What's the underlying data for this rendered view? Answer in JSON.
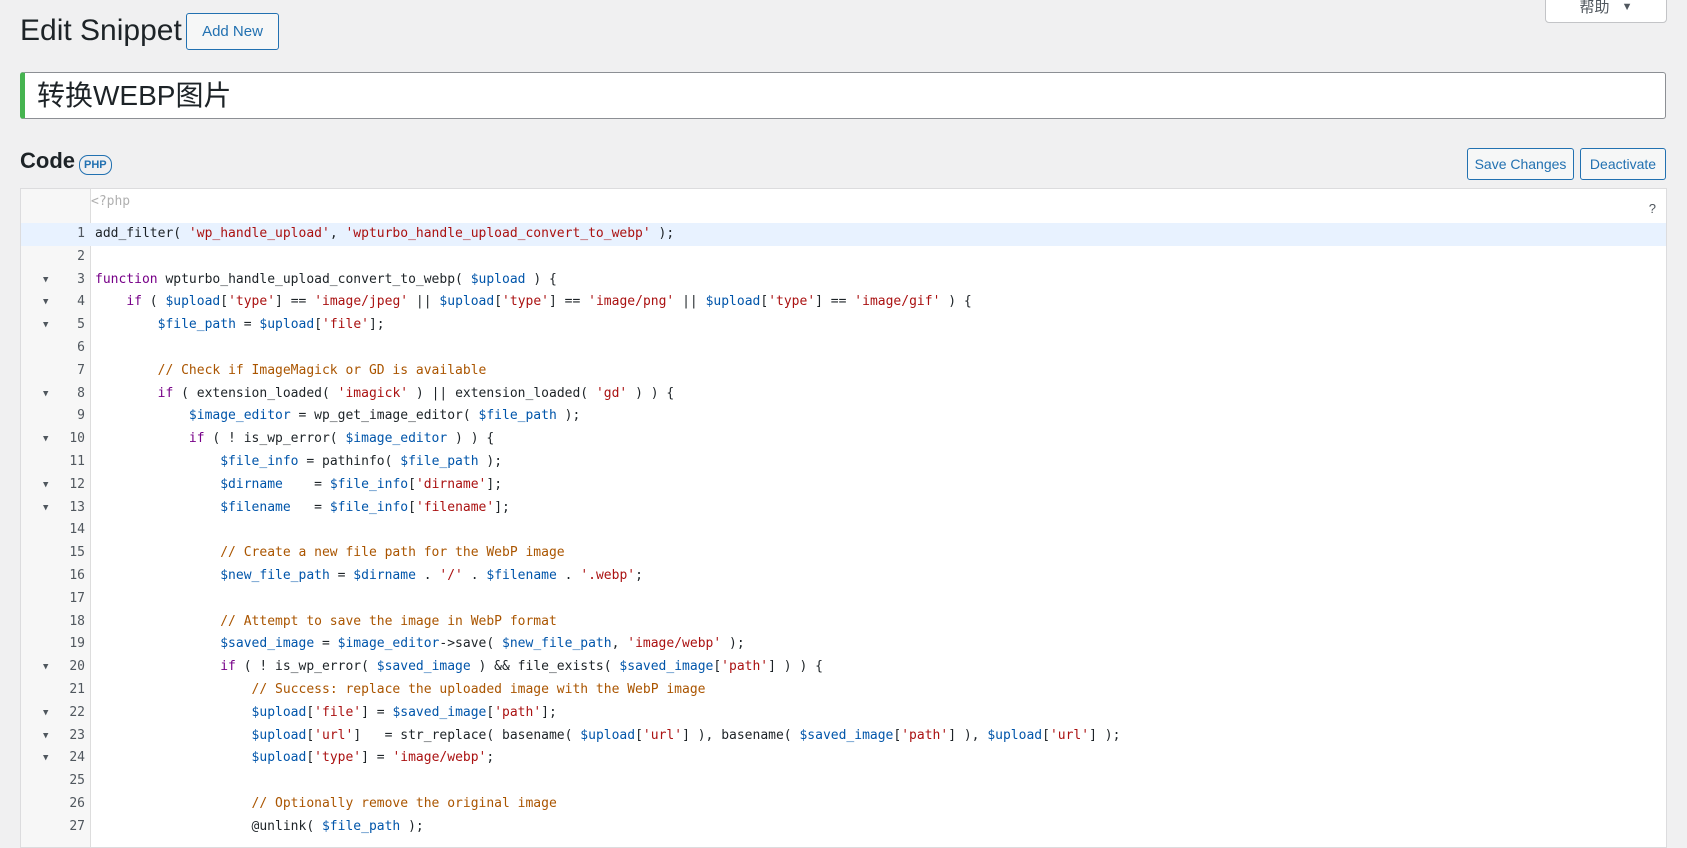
{
  "help_tab": {
    "label": "帮助"
  },
  "header": {
    "title": "Edit Snippet",
    "add_new_label": "Add New"
  },
  "snippet": {
    "title_value": "转换WEBP图片"
  },
  "code_section": {
    "heading": "Code",
    "language_badge": "PHP",
    "save_label": "Save Changes",
    "deactivate_label": "Deactivate"
  },
  "editor": {
    "php_open_tag": "<?php",
    "help_mark": "?",
    "lines": [
      {
        "n": "1",
        "fold": false,
        "code": "add_filter( 'wp_handle_upload', 'wpturbo_handle_upload_convert_to_webp' );"
      },
      {
        "n": "2",
        "fold": false,
        "code": ""
      },
      {
        "n": "3",
        "fold": true,
        "code": "function wpturbo_handle_upload_convert_to_webp( $upload ) {"
      },
      {
        "n": "4",
        "fold": true,
        "code": "    if ( $upload['type'] == 'image/jpeg' || $upload['type'] == 'image/png' || $upload['type'] == 'image/gif' ) {"
      },
      {
        "n": "5",
        "fold": true,
        "code": "        $file_path = $upload['file'];"
      },
      {
        "n": "6",
        "fold": false,
        "code": ""
      },
      {
        "n": "7",
        "fold": false,
        "code": "        // Check if ImageMagick or GD is available"
      },
      {
        "n": "8",
        "fold": true,
        "code": "        if ( extension_loaded( 'imagick' ) || extension_loaded( 'gd' ) ) {"
      },
      {
        "n": "9",
        "fold": false,
        "code": "            $image_editor = wp_get_image_editor( $file_path );"
      },
      {
        "n": "10",
        "fold": true,
        "code": "            if ( ! is_wp_error( $image_editor ) ) {"
      },
      {
        "n": "11",
        "fold": false,
        "code": "                $file_info = pathinfo( $file_path );"
      },
      {
        "n": "12",
        "fold": true,
        "code": "                $dirname    = $file_info['dirname'];"
      },
      {
        "n": "13",
        "fold": true,
        "code": "                $filename   = $file_info['filename'];"
      },
      {
        "n": "14",
        "fold": false,
        "code": ""
      },
      {
        "n": "15",
        "fold": false,
        "code": "                // Create a new file path for the WebP image"
      },
      {
        "n": "16",
        "fold": false,
        "code": "                $new_file_path = $dirname . '/' . $filename . '.webp';"
      },
      {
        "n": "17",
        "fold": false,
        "code": ""
      },
      {
        "n": "18",
        "fold": false,
        "code": "                // Attempt to save the image in WebP format"
      },
      {
        "n": "19",
        "fold": false,
        "code": "                $saved_image = $image_editor->save( $new_file_path, 'image/webp' );"
      },
      {
        "n": "20",
        "fold": true,
        "code": "                if ( ! is_wp_error( $saved_image ) && file_exists( $saved_image['path'] ) ) {"
      },
      {
        "n": "21",
        "fold": false,
        "code": "                    // Success: replace the uploaded image with the WebP image"
      },
      {
        "n": "22",
        "fold": true,
        "code": "                    $upload['file'] = $saved_image['path'];"
      },
      {
        "n": "23",
        "fold": true,
        "code": "                    $upload['url']   = str_replace( basename( $upload['url'] ), basename( $saved_image['path'] ), $upload['url'] );"
      },
      {
        "n": "24",
        "fold": true,
        "code": "                    $upload['type'] = 'image/webp';"
      },
      {
        "n": "25",
        "fold": false,
        "code": ""
      },
      {
        "n": "26",
        "fold": false,
        "code": "                    // Optionally remove the original image"
      },
      {
        "n": "27",
        "fold": false,
        "code": "                    @unlink( $file_path );"
      }
    ]
  },
  "colors": {
    "accent": "#2271b1",
    "title_border": "#46b450",
    "active_line": "#e8f2ff",
    "string": "#aa1111",
    "keyword": "#770088",
    "variable": "#0055aa",
    "comment": "#aa5500"
  }
}
